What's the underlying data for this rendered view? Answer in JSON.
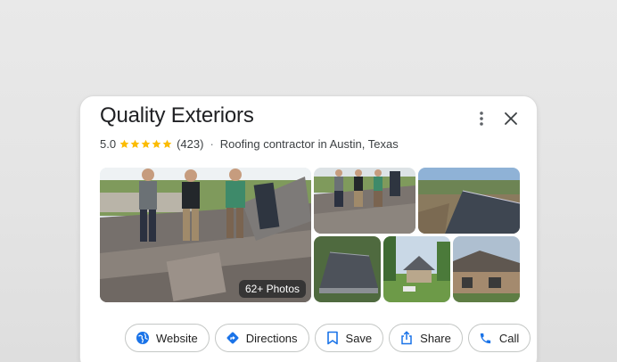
{
  "listing": {
    "title": "Quality Exteriors",
    "rating": "5.0",
    "stars": 5,
    "review_count": "(423)",
    "separator": "·",
    "category": "Roofing contractor in Austin, Texas"
  },
  "photos": {
    "count_label": "62+ Photos"
  },
  "actions": {
    "website": "Website",
    "directions": "Directions",
    "save": "Save",
    "share": "Share",
    "call": "Call"
  },
  "colors": {
    "star": "#fbbc04",
    "accent": "#1a73e8",
    "title": "#202124"
  },
  "icons": {
    "more": "more-vert-icon",
    "close": "close-icon",
    "website": "globe-icon",
    "directions": "directions-icon",
    "save": "bookmark-icon",
    "share": "share-icon",
    "call": "phone-icon"
  }
}
